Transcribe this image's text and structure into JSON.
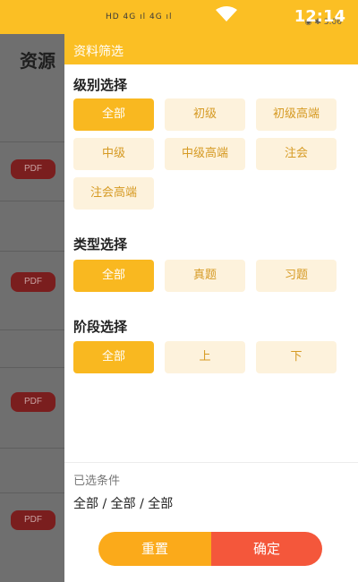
{
  "status_bar": {
    "left_text": "HD 4G ıl 4G ıl",
    "right_icons_text": "◉ ✱ 3:06",
    "time": "12:14"
  },
  "background_page": {
    "title": "资源",
    "pdf_badges": [
      "PDF",
      "PDF",
      "PDF",
      "PDF"
    ]
  },
  "drawer": {
    "header_title": "资料筛选",
    "sections": [
      {
        "title": "级别选择",
        "options": [
          "全部",
          "初级",
          "初级高端",
          "中级",
          "中级高端",
          "注会",
          "注会高端"
        ],
        "selected": "全部"
      },
      {
        "title": "类型选择",
        "options": [
          "全部",
          "真题",
          "习题"
        ],
        "selected": "全部"
      },
      {
        "title": "阶段选择",
        "options": [
          "全部",
          "上",
          "下"
        ],
        "selected": "全部"
      }
    ],
    "selected_conditions_label": "已选条件",
    "selected_conditions_value": "全部 / 全部 / 全部",
    "reset_label": "重置",
    "confirm_label": "确定"
  },
  "colors": {
    "accent": "#fbbf24",
    "option_bg": "#fdf2dc",
    "option_active": "#f9b820",
    "confirm": "#f4573b"
  }
}
